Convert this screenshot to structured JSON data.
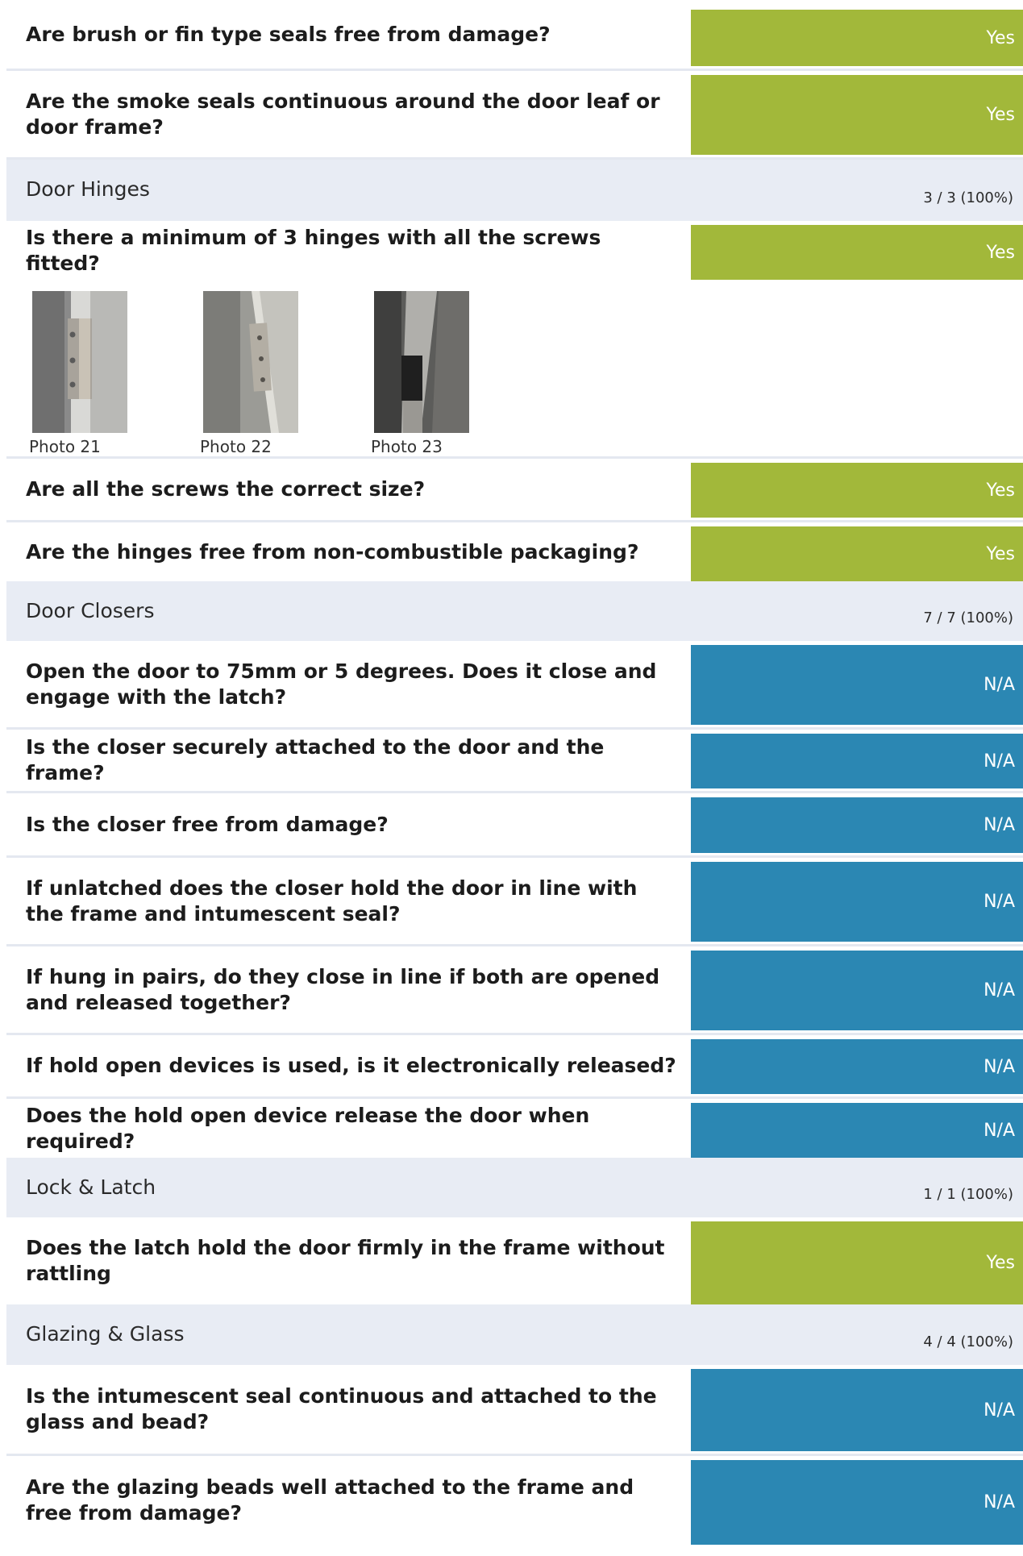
{
  "sections": [
    {
      "type": "questions",
      "questions": [
        {
          "text": "Are brush or fin type seals free from damage?",
          "answer": "Yes"
        },
        {
          "text": "Are the smoke seals continuous around the door leaf or door frame?",
          "answer": "Yes"
        }
      ]
    },
    {
      "type": "group",
      "title": "Door Hinges",
      "score": "3 / 3 (100%)",
      "questions": [
        {
          "text": "Is there a minimum of 3 hinges with all the screws fitted?",
          "answer": "Yes"
        },
        {
          "text": "Are all the screws the correct size?",
          "answer": "Yes"
        },
        {
          "text": "Are the hinges free from non-combustible packaging?",
          "answer": "Yes"
        }
      ],
      "photos": [
        "Photo 21",
        "Photo 22",
        "Photo 23"
      ]
    },
    {
      "type": "group",
      "title": "Door Closers",
      "score": "7 / 7 (100%)",
      "questions": [
        {
          "text": "Open the door to 75mm or 5 degrees. Does it close and engage with the latch?",
          "answer": "N/A"
        },
        {
          "text": "Is the closer securely attached to the door and the frame?",
          "answer": "N/A"
        },
        {
          "text": "Is the closer free from damage?",
          "answer": "N/A"
        },
        {
          "text": "If unlatched does the closer hold the door in line with the frame and intumescent seal?",
          "answer": "N/A"
        },
        {
          "text": "If hung in pairs, do they close in line if both are opened and released together?",
          "answer": "N/A"
        },
        {
          "text": "If hold open devices is used, is it electronically released?",
          "answer": "N/A"
        },
        {
          "text": "Does the hold open device release the door when required?",
          "answer": "N/A"
        }
      ]
    },
    {
      "type": "group",
      "title": "Lock & Latch",
      "score": "1 / 1 (100%)",
      "questions": [
        {
          "text": "Does the latch hold the door firmly in the frame without rattling",
          "answer": "Yes"
        }
      ]
    },
    {
      "type": "group",
      "title": "Glazing & Glass",
      "score": "4 / 4 (100%)",
      "questions": [
        {
          "text": "Is the intumescent seal continuous and attached to the glass and bead?",
          "answer": "N/A"
        },
        {
          "text": "Are the glazing beads well attached to the frame and free from damage?",
          "answer": "N/A"
        }
      ]
    }
  ],
  "colors": {
    "yes": "#a2b83a",
    "na": "#2b87b3",
    "section_bg": "#e8ecf4",
    "divider": "#e4e8f0"
  }
}
